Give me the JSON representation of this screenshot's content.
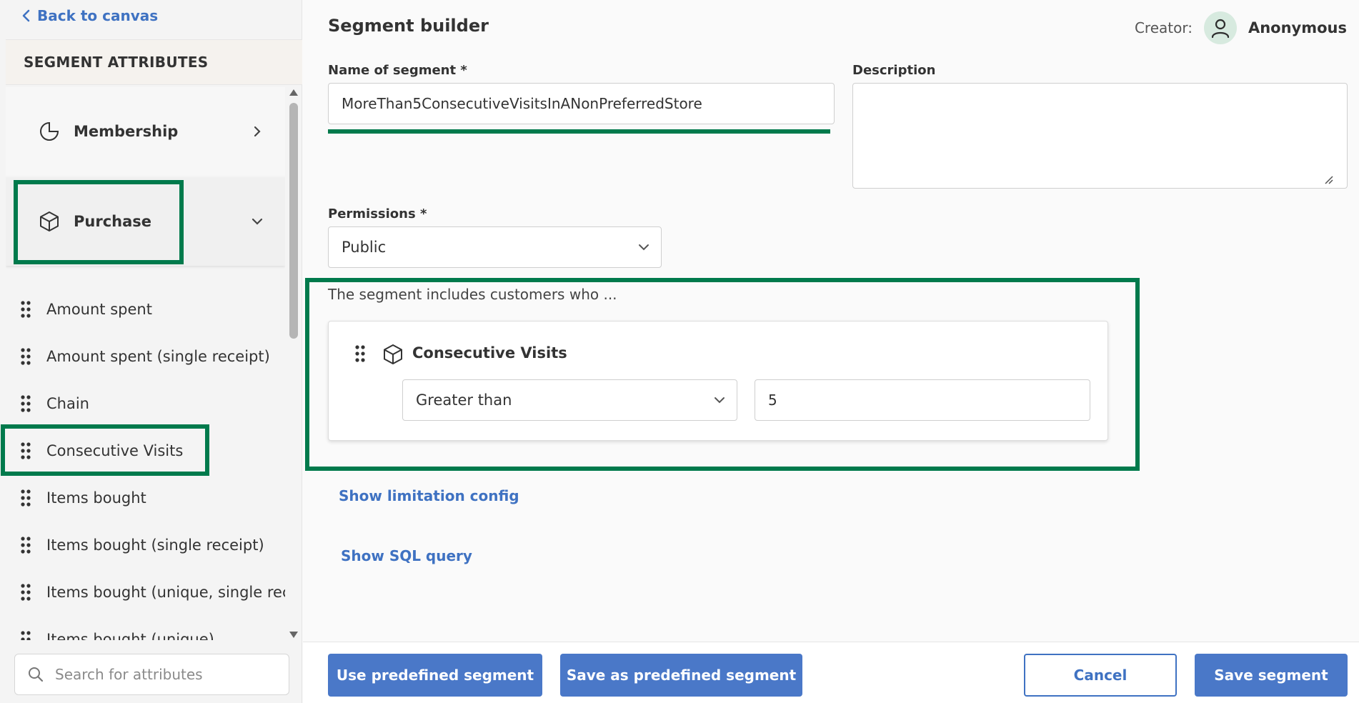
{
  "sidebar": {
    "back_label": "Back to canvas",
    "section_title": "SEGMENT ATTRIBUTES",
    "groups": [
      {
        "label": "Membership",
        "icon": "pie-chart-icon",
        "expanded": false
      },
      {
        "label": "Purchase",
        "icon": "box-icon",
        "expanded": true
      }
    ],
    "items": [
      {
        "label": "Amount spent"
      },
      {
        "label": "Amount spent (single receipt)"
      },
      {
        "label": "Chain"
      },
      {
        "label": "Consecutive Visits"
      },
      {
        "label": "Items bought"
      },
      {
        "label": "Items bought (single receipt)"
      },
      {
        "label": "Items bought (unique, single receipt)"
      },
      {
        "label": "Items bought (unique)"
      }
    ],
    "search_placeholder": "Search for attributes"
  },
  "main": {
    "title": "Segment builder",
    "creator_label": "Creator:",
    "creator_name": "Anonymous",
    "name_label": "Name of segment *",
    "name_value": "MoreThan5ConsecutiveVisitsInANonPreferredStore",
    "description_label": "Description",
    "description_value": "",
    "permissions_label": "Permissions *",
    "permissions_value": "Public",
    "rules_intro": "The segment includes customers who ...",
    "rule": {
      "title": "Consecutive Visits",
      "operator": "Greater than",
      "value": "5"
    },
    "limitation_link": "Show limitation config",
    "sql_link": "Show SQL query"
  },
  "footer": {
    "use_predefined": "Use predefined segment",
    "save_predefined": "Save as predefined segment",
    "cancel": "Cancel",
    "save": "Save segment"
  },
  "colors": {
    "accent": "#3f72c2",
    "highlight": "#007a4c",
    "primary_button": "#4a78c8"
  }
}
